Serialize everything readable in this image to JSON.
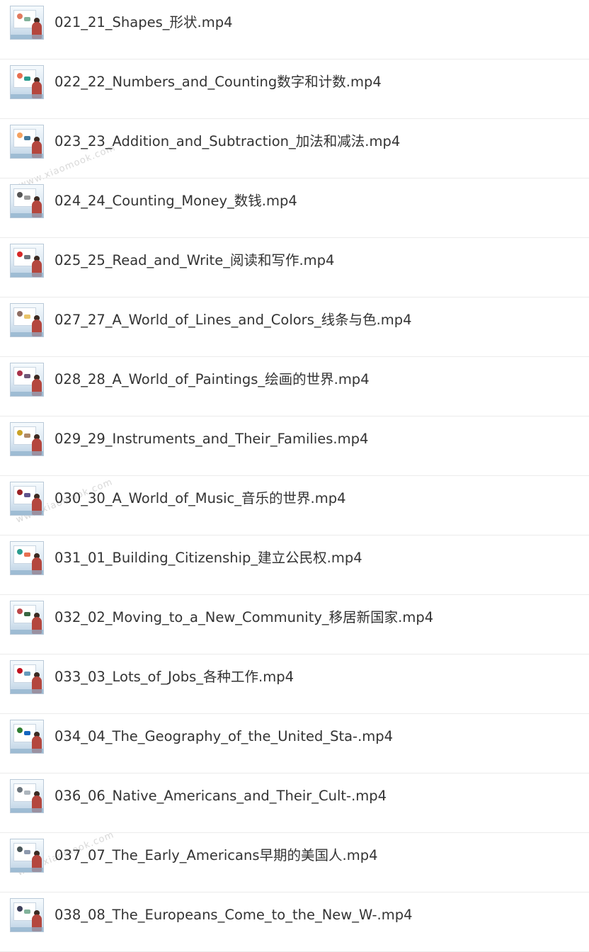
{
  "watermark": "www.xiaomook.com",
  "files": [
    {
      "name": "021_21_Shapes_形状.mp4"
    },
    {
      "name": "022_22_Numbers_and_Counting数字和计数.mp4"
    },
    {
      "name": "023_23_Addition_and_Subtraction_加法和减法.mp4"
    },
    {
      "name": "024_24_Counting_Money_数钱.mp4"
    },
    {
      "name": "025_25_Read_and_Write_阅读和写作.mp4"
    },
    {
      "name": "027_27_A_World_of_Lines_and_Colors_线条与色.mp4"
    },
    {
      "name": "028_28_A_World_of_Paintings_绘画的世界.mp4"
    },
    {
      "name": "029_29_Instruments_and_Their_Families.mp4"
    },
    {
      "name": "030_30_A_World_of_Music_音乐的世界.mp4"
    },
    {
      "name": "031_01_Building_Citizenship_建立公民权.mp4"
    },
    {
      "name": "032_02_Moving_to_a_New_Community_移居新国家.mp4"
    },
    {
      "name": "033_03_Lots_of_Jobs_各种工作.mp4"
    },
    {
      "name": "034_04_The_Geography_of_the_United_Sta-.mp4"
    },
    {
      "name": "036_06_Native_Americans_and_Their_Cult-.mp4"
    },
    {
      "name": "037_07_The_Early_Americans早期的美国人.mp4"
    },
    {
      "name": "038_08_The_Europeans_Come_to_the_New_W-.mp4"
    }
  ],
  "colors": {
    "text": "#333333",
    "divider": "#ececec",
    "background": "#ffffff"
  },
  "icons": {
    "thumbnail": "video-thumbnail-icon"
  }
}
